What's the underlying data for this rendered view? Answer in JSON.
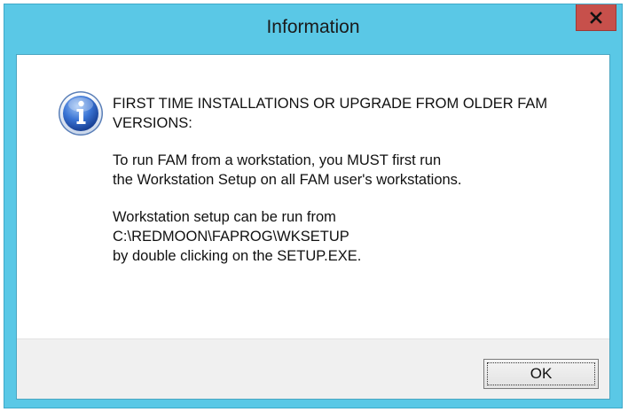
{
  "window": {
    "title": "Information",
    "title_bar_color": "#5ac8e6",
    "close_button_color": "#c7504b"
  },
  "dialog": {
    "icon": "info-icon",
    "heading_lines": [
      "FIRST TIME INSTALLATIONS OR UPGRADE FROM OLDER FAM",
      "VERSIONS:"
    ],
    "paragraph1_lines": [
      "To run FAM from a workstation, you MUST first run",
      "the Workstation Setup on all FAM user's workstations."
    ],
    "paragraph2_lines": [
      "Workstation setup can be run from",
      "C:\\REDMOON\\FAPROG\\WKSETUP",
      "by double clicking on the SETUP.EXE."
    ]
  },
  "buttons": {
    "ok_label": "OK"
  }
}
